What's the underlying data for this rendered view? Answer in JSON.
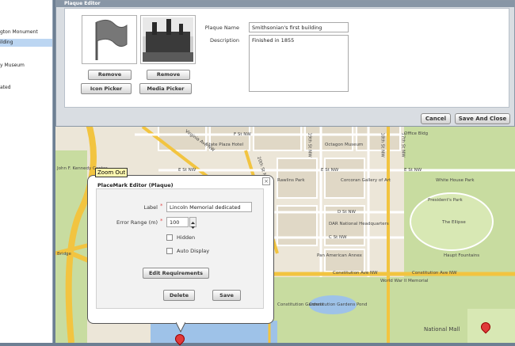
{
  "left_panel": {
    "items": [
      {
        "label": "gton Monument",
        "selected": false
      },
      {
        "label": "ilding",
        "selected": true
      },
      {
        "label": "y Museum",
        "selected": false
      },
      {
        "label": "ated",
        "selected": false
      }
    ]
  },
  "plaque_editor": {
    "title": "Plaque Editor",
    "remove_icon_label": "Remove",
    "icon_picker_label": "Icon Picker",
    "remove_media_label": "Remove",
    "media_picker_label": "Media Picker",
    "name_label": "Plaque Name",
    "name_value": "Smithsonian's first building",
    "description_label": "Description",
    "description_value": "Finished in 1855",
    "cancel_label": "Cancel",
    "save_close_label": "Save And Close"
  },
  "placemark_editor": {
    "zoom_out_label": "Zoom Out",
    "title": "PlaceMark Editor (Plaque)",
    "close_glyph": "×",
    "label_label": "Label",
    "label_value": "Lincoln Memorial dedicated",
    "error_range_label": "Error Range (m)",
    "error_range_value": "100",
    "required_marker": "*",
    "hidden_label": "Hidden",
    "auto_display_label": "Auto Display",
    "edit_requirements_label": "Edit Requirements",
    "delete_label": "Delete",
    "save_label": "Save"
  },
  "map_labels": [
    "F St NW",
    "E St NW",
    "Virginia Ave NW",
    "E St NW",
    "Rawlins Park",
    "Octagon Museum",
    "Corcoran Gallery of Art",
    "E St NW",
    "White House Park",
    "President's Park",
    "D St NW",
    "DAR National Headquarters",
    "The Ellipse",
    "C St NW",
    "Pan American Annex",
    "Haupt Fountains",
    "Constitution Ave NW",
    "Constitution Ave NW",
    "Constitution Gardens",
    "Constitution Gardens Pond",
    "World War II Memorial",
    "National Mall",
    "John F. Kennedy Center",
    "Bridge",
    "17th St NW",
    "18th St NW",
    "19th St NW",
    "20th St NW",
    "Office Bldg",
    "State Plaza Hotel"
  ],
  "colors": {
    "highway": "#f2c440",
    "park": "#c8dca0",
    "water": "#9ec2e8",
    "pin": "#e03a3a",
    "selection": "#bcd6f2"
  },
  "icons": [
    "flag-icon",
    "building-photo",
    "spin-up-icon",
    "spin-down-icon",
    "close-icon",
    "map-pin-icon"
  ]
}
